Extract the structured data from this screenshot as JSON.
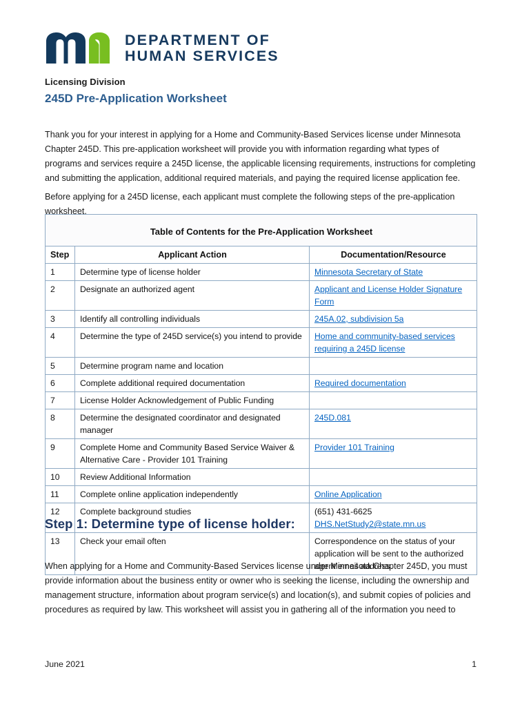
{
  "brand": {
    "logo_icon": "mn-logo-icon",
    "logo_navy": "#13395c",
    "logo_green": "#78be21",
    "dept_line1": "DEPARTMENT OF",
    "dept_line2": "HUMAN SERVICES",
    "dept_color": "#16395e"
  },
  "header": {
    "division": "Licensing Division",
    "title": "245D Pre-Application Worksheet",
    "title_color": "#2c5d8f"
  },
  "body": {
    "intro": "Thank you for your interest in applying for a Home and Community-Based Services license under Minnesota Chapter 245D. This pre-application worksheet will provide you with information regarding what types of programs and services require a 245D license, the applicable licensing requirements, instructions for completing and submitting the application, additional required materials, and paying the required license application fee.",
    "before_applying": "Before applying for a 245D license, each applicant must complete the following steps of the pre-application worksheet."
  },
  "table": {
    "caption": "Table of Contents for the Pre-Application Worksheet",
    "columns": [
      "Step",
      "Applicant Action",
      "Documentation/Resource"
    ],
    "border_color": "#8faac4",
    "link_color": "#0563c1",
    "rows": [
      {
        "step": "1",
        "action": "Determine type of license holder",
        "doc": [
          {
            "text": "Minnesota Secretary of State",
            "link": true
          }
        ]
      },
      {
        "step": "2",
        "action": "Designate an authorized agent",
        "doc": [
          {
            "text": "Applicant and License Holder Signature Form",
            "link": true
          }
        ]
      },
      {
        "step": "3",
        "action": "Identify all controlling individuals",
        "doc": [
          {
            "text": "245A.02, subdivision 5a",
            "link": true
          }
        ]
      },
      {
        "step": "4",
        "action": "Determine the type of 245D service(s) you intend to provide",
        "doc": [
          {
            "text": "Home and community-based services requiring a 245D license",
            "link": true
          }
        ]
      },
      {
        "step": "5",
        "action": "Determine program name and location",
        "doc": []
      },
      {
        "step": "6",
        "action": "Complete additional required documentation",
        "doc": [
          {
            "text": "Required documentation",
            "link": true
          }
        ]
      },
      {
        "step": "7",
        "action": "License Holder Acknowledgement of Public Funding",
        "doc": []
      },
      {
        "step": "8",
        "action": "Determine the designated coordinator and designated manager",
        "doc": [
          {
            "text": "245D.081",
            "link": true
          }
        ]
      },
      {
        "step": "9",
        "action": "Complete Home and Community Based Service Waiver & Alternative Care - Provider 101 Training",
        "doc": [
          {
            "text": "Provider 101 Training",
            "link": true
          }
        ]
      },
      {
        "step": "10",
        "action": "Review Additional Information",
        "doc": []
      },
      {
        "step": "11",
        "action": "Complete online application independently",
        "doc": [
          {
            "text": "Online Application",
            "link": true
          }
        ]
      },
      {
        "step": "12",
        "action": "Complete background studies",
        "doc": [
          {
            "text": "(651) 431-6625",
            "link": false
          },
          {
            "text": "DHS.NetStudy2@state.mn.us",
            "link": true
          }
        ]
      },
      {
        "step": "13",
        "action": "Check your email often",
        "doc": [
          {
            "text": "Correspondence on the status of your application will be sent to the authorized agent email address.",
            "link": false
          }
        ]
      }
    ]
  },
  "step1": {
    "heading": "Step 1: Determine type of license holder:",
    "heading_color": "#1f3864",
    "paragraph": "When applying for a Home and Community-Based Services license under Minnesota Chapter 245D, you must provide information about the business entity or owner who is seeking the license, including the ownership and management structure, information about program service(s) and location(s), and submit copies of policies and procedures as required by law.  This worksheet will assist you in gathering all of the information you need to"
  },
  "footer": {
    "date": "June 2021",
    "page_number": "1"
  }
}
